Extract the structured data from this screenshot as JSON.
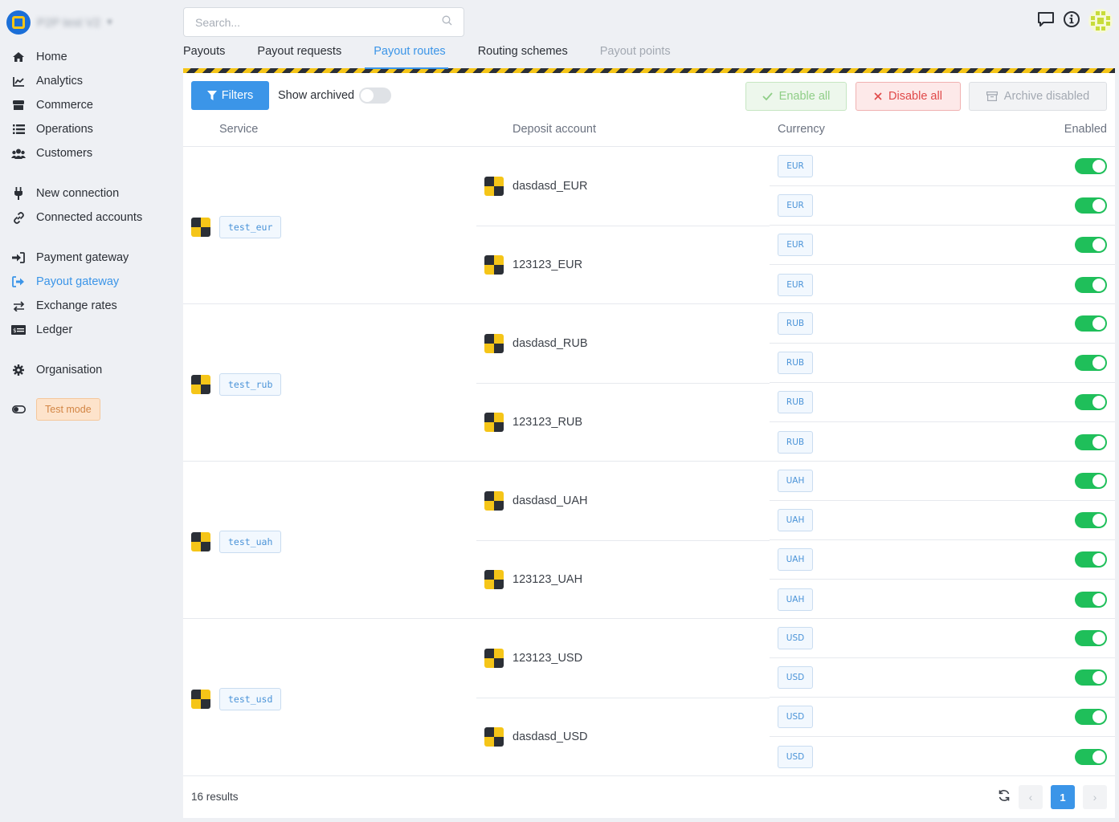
{
  "org": {
    "name": "P2P test V2"
  },
  "sidebar": {
    "items": [
      {
        "label": "Home",
        "icon": "home-icon"
      },
      {
        "label": "Analytics",
        "icon": "analytics-icon"
      },
      {
        "label": "Commerce",
        "icon": "commerce-icon"
      },
      {
        "label": "Operations",
        "icon": "list-icon"
      },
      {
        "label": "Customers",
        "icon": "users-icon"
      },
      {
        "label": "New connection",
        "icon": "plug-icon"
      },
      {
        "label": "Connected accounts",
        "icon": "link-icon"
      },
      {
        "label": "Payment gateway",
        "icon": "sign-in-icon"
      },
      {
        "label": "Payout gateway",
        "icon": "sign-out-icon",
        "active": true
      },
      {
        "label": "Exchange rates",
        "icon": "exchange-icon"
      },
      {
        "label": "Ledger",
        "icon": "money-bill-icon"
      },
      {
        "label": "Organisation",
        "icon": "gear-icon"
      }
    ],
    "test_mode": "Test mode"
  },
  "search": {
    "placeholder": "Search..."
  },
  "tabs": [
    {
      "label": "Payouts"
    },
    {
      "label": "Payout requests"
    },
    {
      "label": "Payout routes",
      "active": true
    },
    {
      "label": "Routing schemes"
    },
    {
      "label": "Payout points",
      "disabled": true
    }
  ],
  "toolbar": {
    "filters": "Filters",
    "show_archived": "Show archived",
    "enable_all": "Enable all",
    "disable_all": "Disable all",
    "archive_disabled": "Archive disabled"
  },
  "table": {
    "headers": {
      "service": "Service",
      "deposit_account": "Deposit account",
      "currency": "Currency",
      "enabled": "Enabled"
    },
    "groups": [
      {
        "service": "test_eur",
        "accounts": [
          {
            "name": "dasdasd_EUR",
            "currencies": [
              "EUR",
              "EUR"
            ]
          },
          {
            "name": "123123_EUR",
            "currencies": [
              "EUR",
              "EUR"
            ]
          }
        ]
      },
      {
        "service": "test_rub",
        "accounts": [
          {
            "name": "dasdasd_RUB",
            "currencies": [
              "RUB",
              "RUB"
            ]
          },
          {
            "name": "123123_RUB",
            "currencies": [
              "RUB",
              "RUB"
            ]
          }
        ]
      },
      {
        "service": "test_uah",
        "accounts": [
          {
            "name": "dasdasd_UAH",
            "currencies": [
              "UAH",
              "UAH"
            ]
          },
          {
            "name": "123123_UAH",
            "currencies": [
              "UAH",
              "UAH"
            ]
          }
        ]
      },
      {
        "service": "test_usd",
        "accounts": [
          {
            "name": "123123_USD",
            "currencies": [
              "USD",
              "USD"
            ]
          },
          {
            "name": "dasdasd_USD",
            "currencies": [
              "USD",
              "USD"
            ]
          }
        ]
      }
    ]
  },
  "footer": {
    "results": "16 results",
    "current_page": "1"
  },
  "colors": {
    "accent": "#3b95e8",
    "toggle_on": "#1fbf5a",
    "brand_yellow": "#f5c518"
  }
}
